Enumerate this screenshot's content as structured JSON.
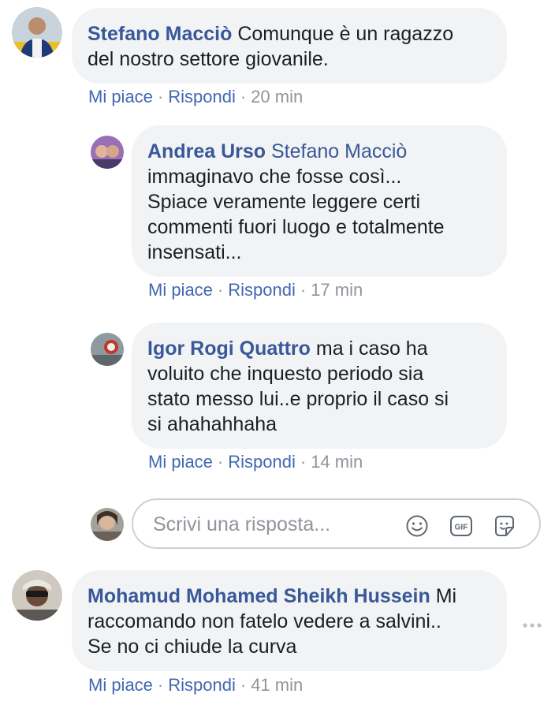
{
  "comments": [
    {
      "author": "Stefano Macciò",
      "text_lines": [
        "Comunque è un ragazzo",
        "del nostro settore giovanile."
      ],
      "like_label": "Mi piace",
      "reply_label": "Rispondi",
      "time": "20 min"
    },
    {
      "author": "Andrea Urso",
      "mention": "Stefano Macciò",
      "text_lines": [
        "immaginavo che fosse così...",
        "Spiace veramente leggere certi",
        "commenti fuori luogo e totalmente",
        "insensati..."
      ],
      "like_label": "Mi piace",
      "reply_label": "Rispondi",
      "time": "17 min"
    },
    {
      "author": "Igor Rogi Quattro",
      "text_first": "ma i caso ha",
      "text_lines": [
        "voluito che inquesto periodo sia",
        "stato messo lui..e proprio il caso si",
        "si ahahahhaha"
      ],
      "like_label": "Mi piace",
      "reply_label": "Rispondi",
      "time": "14 min"
    },
    {
      "author": "Mohamud Mohamed Sheikh Hussein",
      "text_first": "Mi",
      "text_lines": [
        "raccomando non fatelo vedere a salvini..",
        "Se no ci chiude la curva"
      ],
      "like_label": "Mi piace",
      "reply_label": "Rispondi",
      "time": "41 min"
    }
  ],
  "reply_box": {
    "placeholder": "Scrivi una risposta...",
    "icons": [
      "emoji-icon",
      "gif-icon",
      "sticker-icon"
    ]
  },
  "colors": {
    "author": "#385898",
    "link": "#4267b2",
    "meta": "#90949c",
    "bubble": "#f2f3f5"
  }
}
